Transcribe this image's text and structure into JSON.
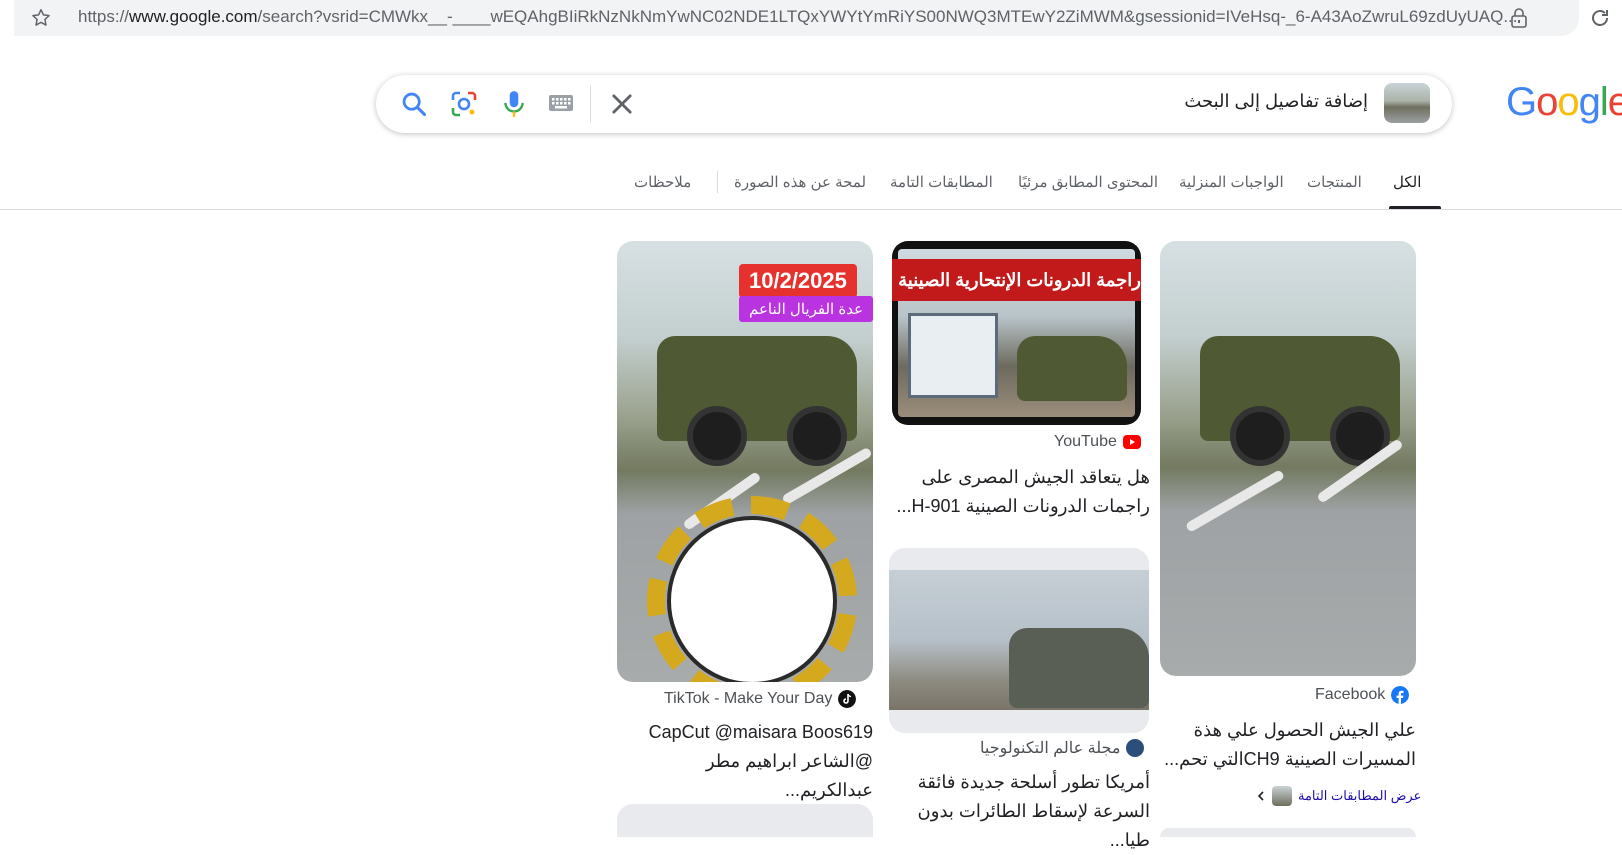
{
  "browser": {
    "url_prefix": "https://",
    "url_domain": "www.google.com",
    "url_rest": "/search?vsrid=CMWkx__-____wEQAhgBIiRkNzNkNmYwNC02NDE1LTQxYWYtYmRiYS00NWQ3MTEwY2ZiMWM&gsessionid=IVeHsq-_6-A43AoZwruL69zdUyUAQ...",
    "icons": [
      "star-icon",
      "lock-icon",
      "reload-icon"
    ]
  },
  "logo": {
    "letters": [
      "G",
      "o",
      "o",
      "g",
      "l",
      "e"
    ],
    "colors": [
      "#4285f4",
      "#ea4335",
      "#fbbc05",
      "#4285f4",
      "#34a853",
      "#ea4335"
    ]
  },
  "search": {
    "placeholder": "إضافة تفاصيل إلى البحث",
    "icons": [
      "search-icon",
      "lens-icon",
      "mic-icon",
      "keyboard-icon",
      "close-icon"
    ]
  },
  "tabs": {
    "all": "الكل",
    "products": "المنتجات",
    "homework": "الواجبات المنزلية",
    "visual": "المحتوى المطابق مرئيًا",
    "exact": "المطابقات التامة",
    "about": "لمحة عن هذه الصورة",
    "notes": "ملاحظات"
  },
  "results": {
    "tiktok": {
      "date_badge": "10/2/2025",
      "purple_badge": "عدة الفريال الناعم",
      "source": "TikTok - Make Your Day",
      "title_line1": "CapCut @maisara Boos619",
      "title_line2": "@الشاعر ابراهيم مطر عبدالكريم..."
    },
    "youtube": {
      "banner": "راجمة الدرونات الإنتحارية الصينية لمصر ؟",
      "source": "YouTube",
      "title_line1": "هل يتعاقد الجيش المصرى على",
      "title_line2": "راجمات الدرونات الصينية H-901..."
    },
    "magazine": {
      "source": "مجلة عالم التكنولوجيا",
      "title_line1": "أمريكا تطور أسلحة جديدة فائقة",
      "title_line2": "السرعة لإسقاط الطائرات بدون طيا..."
    },
    "facebook": {
      "source": "Facebook",
      "title_line1": "علي الجيش الحصول علي هذة",
      "title_line2": "المسيرات الصينية CH9التي تحم...",
      "exact_matches": "عرض المطابقات التامة"
    }
  },
  "colors": {
    "accent_blue": "#1a73e8",
    "youtube_red": "#ff0000",
    "facebook_blue": "#1877f2"
  }
}
